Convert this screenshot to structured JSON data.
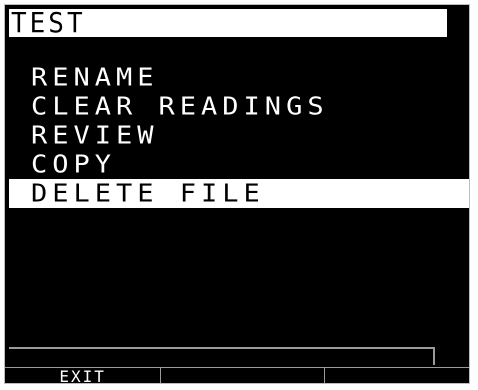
{
  "title": "TEST",
  "menu": {
    "items": [
      {
        "label": "RENAME"
      },
      {
        "label": "CLEAR READINGS"
      },
      {
        "label": "REVIEW"
      },
      {
        "label": "COPY"
      },
      {
        "label": "DELETE FILE"
      }
    ],
    "selected_index": 4
  },
  "softkeys": [
    "EXIT",
    "",
    ""
  ],
  "colors": {
    "screen_background": "#000000",
    "text": "#ffffff",
    "highlight": "#ffffff",
    "highlight_text": "#000000"
  }
}
